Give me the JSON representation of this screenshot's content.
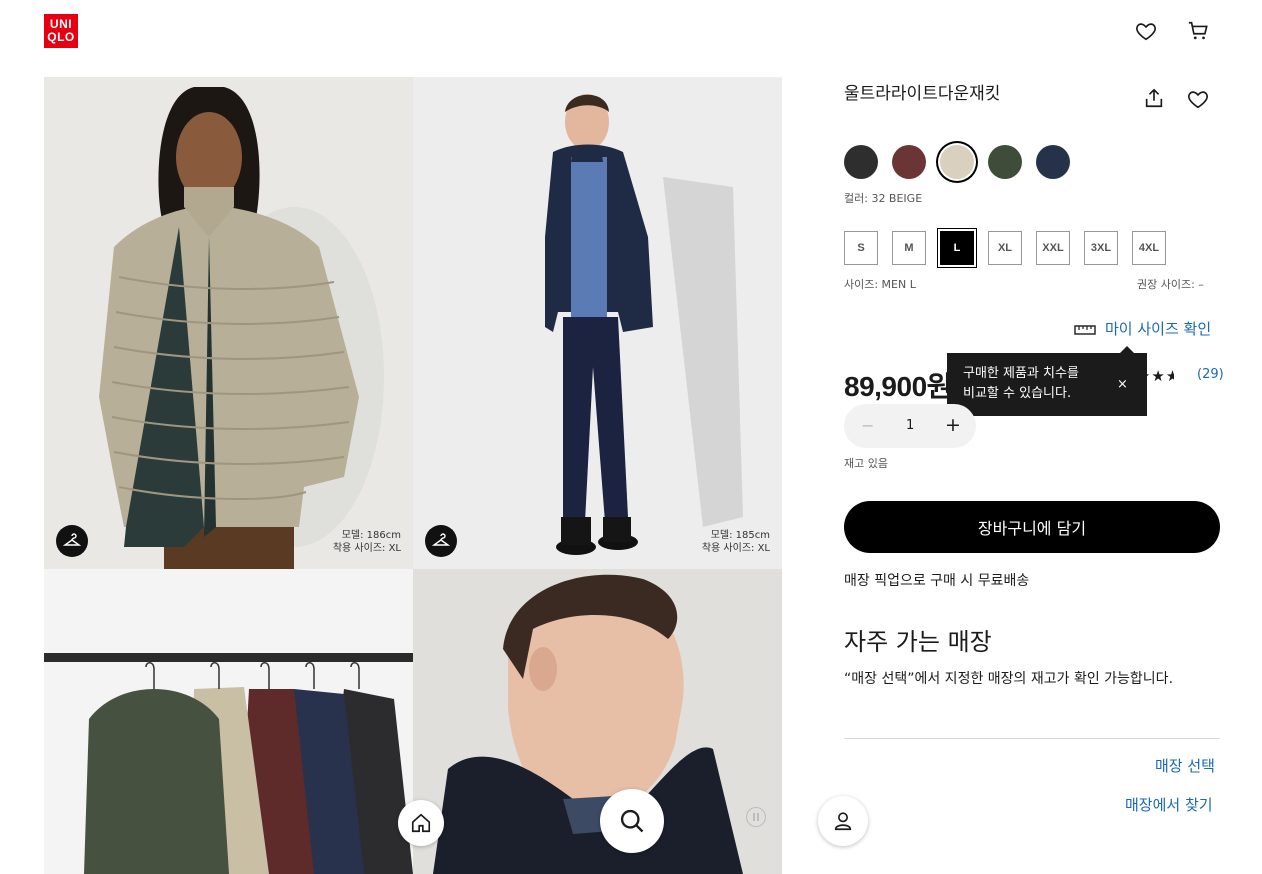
{
  "header": {
    "logo_line1": "UNI",
    "logo_line2": "QLO"
  },
  "gallery": {
    "captions": [
      {
        "height": "모델: 186cm",
        "size": "착용 사이즈: XL"
      },
      {
        "height": "모델: 185cm",
        "size": "착용 사이즈: XL"
      }
    ]
  },
  "product": {
    "title": "울트라라이트다운재킷",
    "colors": [
      {
        "name": "black",
        "hex": "#2e2e2e",
        "selected": false
      },
      {
        "name": "wine",
        "hex": "#6b3535",
        "selected": false
      },
      {
        "name": "beige",
        "hex": "#d9d0bd",
        "selected": true
      },
      {
        "name": "olive",
        "hex": "#3f4c3a",
        "selected": false
      },
      {
        "name": "navy",
        "hex": "#25324a",
        "selected": false
      }
    ],
    "color_label": "컬러: 32 BEIGE",
    "sizes": [
      "S",
      "M",
      "L",
      "XL",
      "XXL",
      "3XL",
      "4XL"
    ],
    "selected_size": "L",
    "size_label": "사이즈: MEN L",
    "recommended_size_label": "권장 사이즈: –",
    "my_size_link": "마이 사이즈 확인",
    "tooltip_line1": "구매한 제품과 치수를",
    "tooltip_line2": "비교할 수 있습니다.",
    "tooltip_close": "×",
    "price": "89,900원",
    "rating_stars": "★★★★",
    "rating_count": "(29)",
    "rating_value": 4.5,
    "quantity": "1",
    "qty_minus": "−",
    "qty_plus": "+",
    "stock_status": "재고 있음",
    "add_to_cart": "장바구니에 담기",
    "pickup_note": "매장 픽업으로 구매 시 무료배송"
  },
  "store": {
    "heading": "자주 가는 매장",
    "desc": "“매장 선택”에서 지정한 매장의 재고가 확인 가능합니다.",
    "select_link": "매장 선택",
    "find_link": "매장에서 찾기"
  },
  "colors": {
    "brand_red": "#e60012",
    "link_blue": "#1a6ab3"
  }
}
